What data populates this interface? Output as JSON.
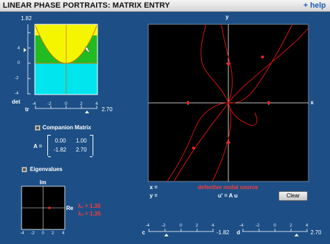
{
  "header": {
    "title": "LINEAR PHASE PORTRAITS: MATRIX ENTRY",
    "help": "+ help"
  },
  "trace_det_plot": {
    "det_axis_label": "det",
    "det_max_label": "1.82",
    "det_ticks": [
      "4",
      "2",
      "0",
      "-2",
      "-4"
    ],
    "tr_axis_label": "tr",
    "tr_ticks": [
      "-4",
      "-2",
      "0",
      "2",
      "4"
    ],
    "tr_value": "2.70",
    "colors": {
      "upper": "#f5f500",
      "middle": "#22bb22",
      "lower": "#00e5ee",
      "parabola": "#cc7700"
    }
  },
  "matrix": {
    "companion_label": "Companion Matrix",
    "a_label": "A =",
    "rows": [
      [
        "0.00",
        "1.00"
      ],
      [
        "-1.82",
        "2.70"
      ]
    ]
  },
  "eigen": {
    "checkbox_label": "Eigenvalues",
    "im_label": "Im",
    "re_label": "Re",
    "ticks": [
      "-4",
      "-2",
      "0",
      "2",
      "4"
    ],
    "lambda1": "λ₁ = 1.35",
    "lambda2": "λ₂ = 1.35"
  },
  "phase_plane": {
    "x_label": "x",
    "y_label": "y",
    "x_readout_label": "x =",
    "y_readout_label": "y =",
    "classification": "defective nodal source",
    "equation": "u' = A u",
    "clear_button": "Clear"
  },
  "sliders": {
    "c_label": "c",
    "c_value": "-1.82",
    "d_label": "d",
    "d_value": "2.70",
    "ticks": [
      "-4",
      "-2",
      "0",
      "2",
      "4"
    ]
  },
  "colors": {
    "panel": "#1d4f86",
    "trajectory": "#dd1111",
    "accent_red": "#ff3b3b"
  }
}
